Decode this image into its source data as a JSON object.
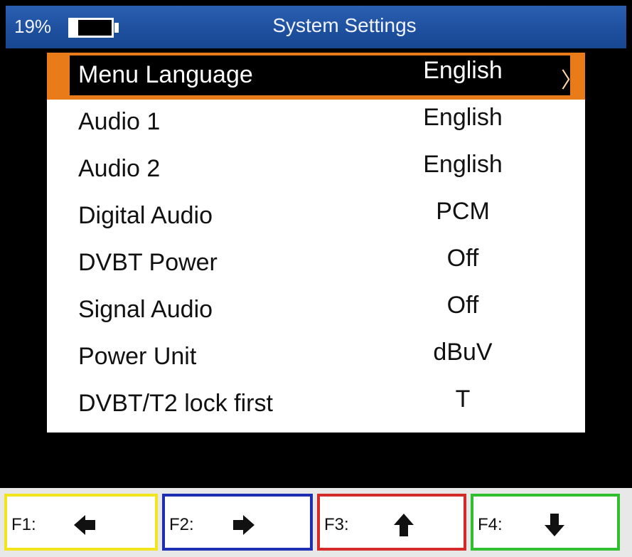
{
  "header": {
    "battery_percent": "19%",
    "battery_level": 0.19,
    "title": "System Settings"
  },
  "settings": [
    {
      "label": "Menu Language",
      "value": "English",
      "selected": true
    },
    {
      "label": "Audio 1",
      "value": "English"
    },
    {
      "label": "Audio 2",
      "value": "English"
    },
    {
      "label": "Digital Audio",
      "value": "PCM"
    },
    {
      "label": "DVBT Power",
      "value": "Off"
    },
    {
      "label": "Signal Audio",
      "value": "Off"
    },
    {
      "label": "Power Unit",
      "value": "dBuV"
    },
    {
      "label": "DVBT/T2 lock first",
      "value": "T"
    }
  ],
  "footer": {
    "keys": [
      {
        "label": "F1:",
        "icon": "arrow-left-icon",
        "color": "#f2e51d"
      },
      {
        "label": "F2:",
        "icon": "arrow-right-icon",
        "color": "#1f2fb4"
      },
      {
        "label": "F3:",
        "icon": "arrow-up-icon",
        "color": "#d52a2a"
      },
      {
        "label": "F4:",
        "icon": "arrow-down-icon",
        "color": "#2fbf2f"
      }
    ]
  },
  "colors": {
    "header_blue": "#1d4f9e",
    "selection_orange": "#ea7b19"
  }
}
